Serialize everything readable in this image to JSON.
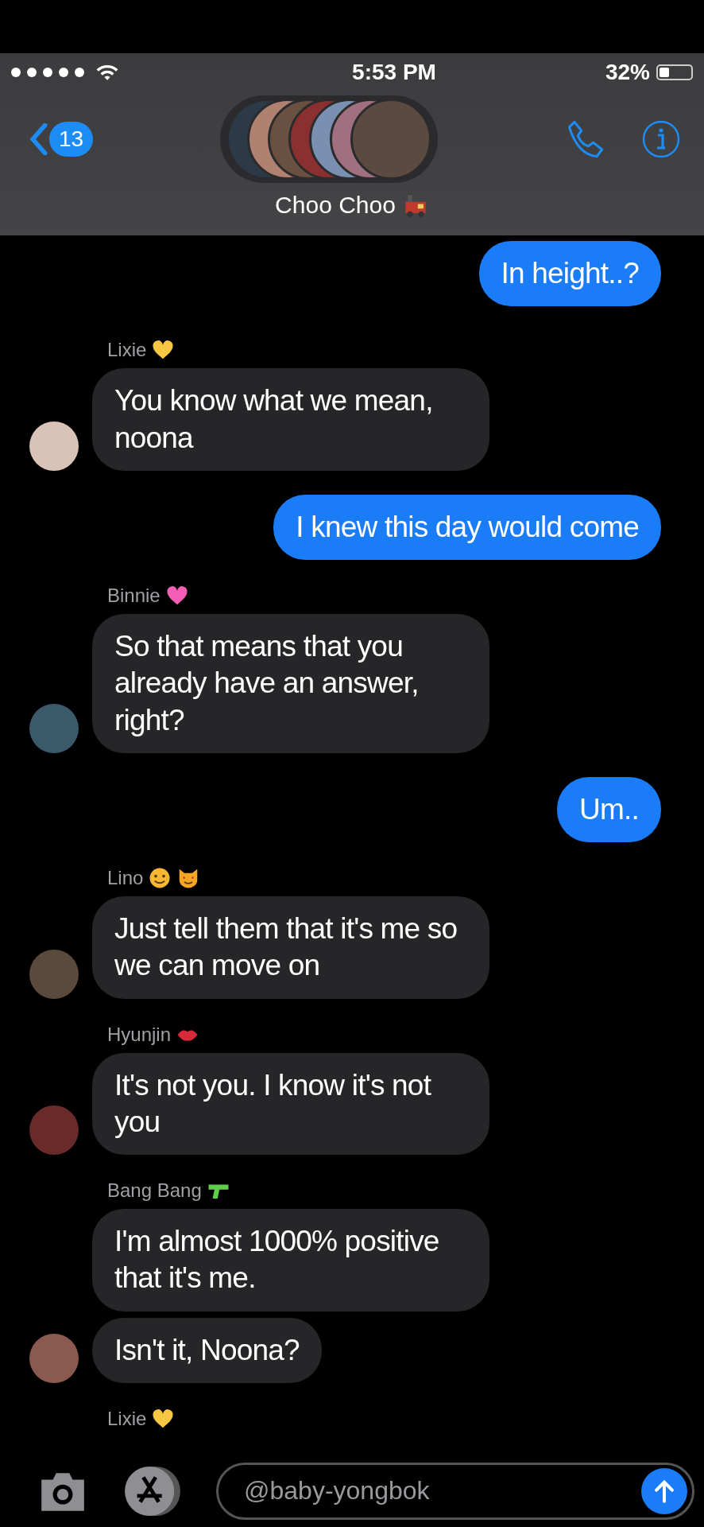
{
  "status_bar": {
    "time": "5:53 PM",
    "battery": "32%"
  },
  "nav": {
    "back_count": "13",
    "title": "Choo Choo",
    "title_badges": [
      {
        "kind": "train",
        "color": "#c0392b"
      }
    ]
  },
  "messages": [
    {
      "kind": "sent",
      "bubbles": [
        "In height..?"
      ]
    },
    {
      "kind": "received",
      "sender": "Lixie",
      "badges": [
        {
          "kind": "heart",
          "color": "#f7c744"
        }
      ],
      "bubbles": [
        "You know what we mean, noona"
      ]
    },
    {
      "kind": "sent",
      "bubbles": [
        "I knew this day would come"
      ]
    },
    {
      "kind": "received",
      "sender": "Binnie",
      "badges": [
        {
          "kind": "heart",
          "color": "#f25fb4"
        }
      ],
      "bubbles": [
        "So that means that you already have an answer, right?"
      ]
    },
    {
      "kind": "sent",
      "bubbles": [
        "Um.."
      ]
    },
    {
      "kind": "received",
      "sender": "Lino",
      "badges": [
        {
          "kind": "smiley",
          "color": "#f7b733"
        },
        {
          "kind": "cat",
          "color": "#f5a623"
        }
      ],
      "bubbles": [
        "Just tell them that it's me so we can move on"
      ]
    },
    {
      "kind": "received",
      "sender": "Hyunjin",
      "badges": [
        {
          "kind": "lips",
          "color": "#d62a3a"
        }
      ],
      "bubbles": [
        "It's not you. I know it's not you"
      ]
    },
    {
      "kind": "received",
      "sender": "Bang Bang",
      "badges": [
        {
          "kind": "pistol",
          "color": "#5fcf4a"
        }
      ],
      "bubbles": [
        "I'm almost 1000% positive that it's me.",
        "Isn't it, Noona?"
      ]
    },
    {
      "kind": "received",
      "sender": "Lixie",
      "badges": [
        {
          "kind": "heart",
          "color": "#f7c744"
        }
      ]
    }
  ],
  "composer": {
    "value": "@baby-yongbok"
  }
}
